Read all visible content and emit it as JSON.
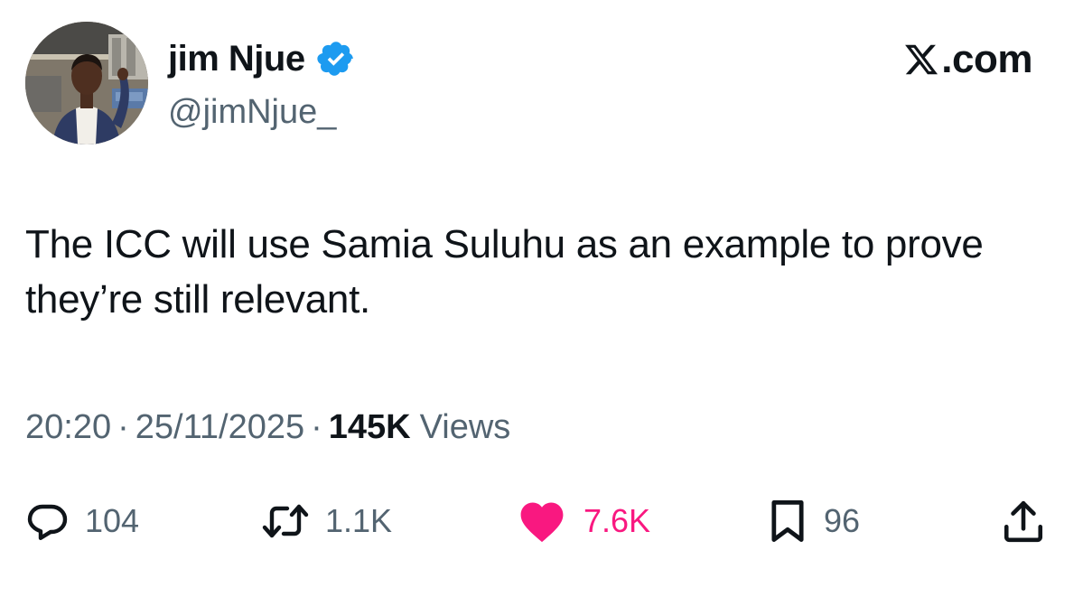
{
  "author": {
    "display_name": "jim Njue",
    "handle": "@jimNjue_",
    "verified": true,
    "verified_color": "#1d9bf0"
  },
  "brand": {
    "logo_icon": "x-logo-icon",
    "logo_text": ".com"
  },
  "tweet": {
    "text": "The ICC will use Samia Suluhu as an example to prove they’re still relevant."
  },
  "meta": {
    "time": "20:20",
    "date": "25/11/2025",
    "separator": "·",
    "views_count": "145K",
    "views_label": "Views"
  },
  "actions": {
    "reply": {
      "icon": "reply-icon",
      "count": "104"
    },
    "repost": {
      "icon": "repost-icon",
      "count": "1.1K"
    },
    "like": {
      "icon": "heart-icon",
      "count": "7.6K",
      "active": true,
      "color": "#f91880"
    },
    "bookmark": {
      "icon": "bookmark-icon",
      "count": "96"
    },
    "share": {
      "icon": "share-icon"
    }
  },
  "colors": {
    "text_primary": "#0f1419",
    "text_secondary": "#536471"
  }
}
